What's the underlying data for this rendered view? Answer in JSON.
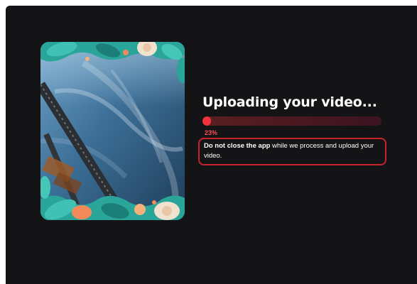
{
  "upload": {
    "title": "Uploading your video...",
    "progress_percent": 23,
    "progress_label": "23%",
    "notice_bold": "Do not close the app",
    "notice_rest": " while we process and upload your video."
  },
  "colors": {
    "background": "#141416",
    "accent": "#f2323f",
    "track": "#4a1820",
    "notice_border": "#c8232c"
  },
  "thumbnail": {
    "description_icon": "video-thumbnail"
  }
}
